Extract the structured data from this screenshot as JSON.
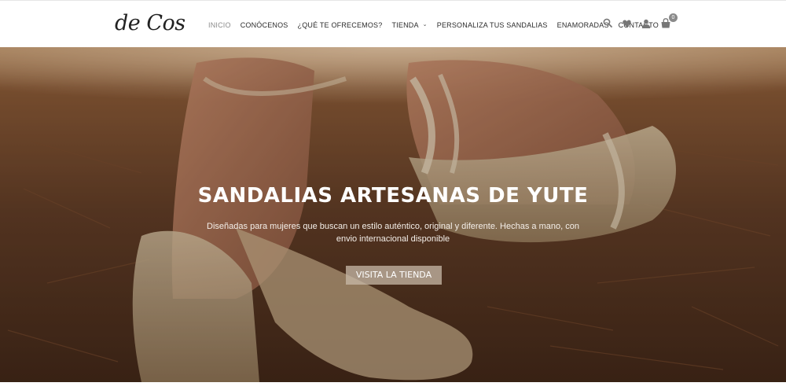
{
  "brand": {
    "logo_text": "de Cos"
  },
  "nav": {
    "items": [
      {
        "label": "INICIO",
        "active": true
      },
      {
        "label": "CONÓCENOS"
      },
      {
        "label": "¿QUÉ TE OFRECEMOS?"
      },
      {
        "label": "TIENDA",
        "has_dropdown": true
      },
      {
        "label": "PERSONALIZA TUS SANDALIAS"
      },
      {
        "label": "ENAMORADAS"
      },
      {
        "label": "CONTACTO"
      }
    ]
  },
  "header_icons": {
    "search": "search-icon",
    "wishlist": "heart-icon",
    "account": "user-icon",
    "cart": "cart-icon",
    "cart_count": "0"
  },
  "hero": {
    "title": "SANDALIAS ARTESANAS DE YUTE",
    "subtitle": "Diseñadas para mujeres que buscan un estilo auténtico, original y diferente. Hechas a mano, con envio internacional disponible",
    "button_label": "VISITA LA TIENDA"
  },
  "colors": {
    "text_dark": "#2b2b2b",
    "nav_active": "#8a8a8a",
    "button_bg": "#c8b9a8"
  }
}
